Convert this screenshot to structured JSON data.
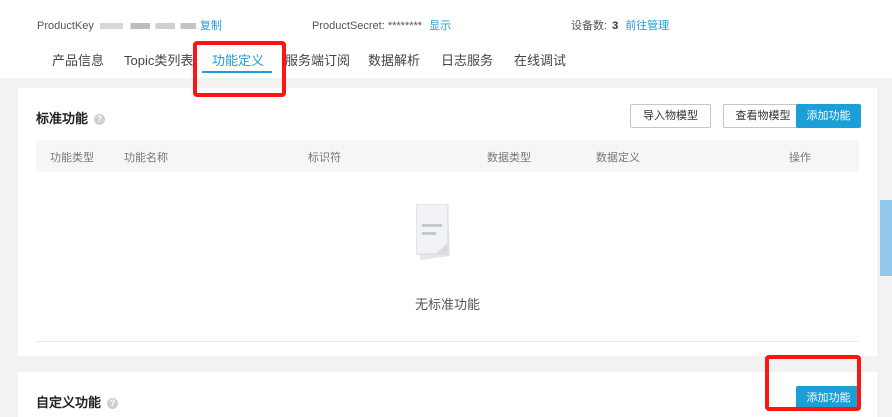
{
  "header": {
    "product_key_label": "ProductKey",
    "copy_label": "复制",
    "product_secret_label": "ProductSecret:",
    "product_secret_value": "********",
    "show_label": "显示",
    "device_count_label": "设备数:",
    "device_count_value": "3",
    "manage_label": "前往管理"
  },
  "tabs": [
    {
      "label": "产品信息"
    },
    {
      "label": "Topic类列表"
    },
    {
      "label": "功能定义"
    },
    {
      "label": "服务端订阅"
    },
    {
      "label": "数据解析"
    },
    {
      "label": "日志服务"
    },
    {
      "label": "在线调试"
    }
  ],
  "active_tab": "功能定义",
  "standard_section": {
    "title": "标准功能",
    "help_icon": "?",
    "buttons": {
      "import": "导入物模型",
      "view": "查看物模型",
      "add": "添加功能"
    },
    "columns": [
      "功能类型",
      "功能名称",
      "标识符",
      "数据类型",
      "数据定义",
      "操作"
    ],
    "empty_text": "无标准功能"
  },
  "custom_section": {
    "title": "自定义功能",
    "help_icon": "?",
    "add_button": "添加功能"
  },
  "colors": {
    "accent": "#1c9ed6",
    "highlight": "#ff1414",
    "background": "#f2f2f2"
  }
}
